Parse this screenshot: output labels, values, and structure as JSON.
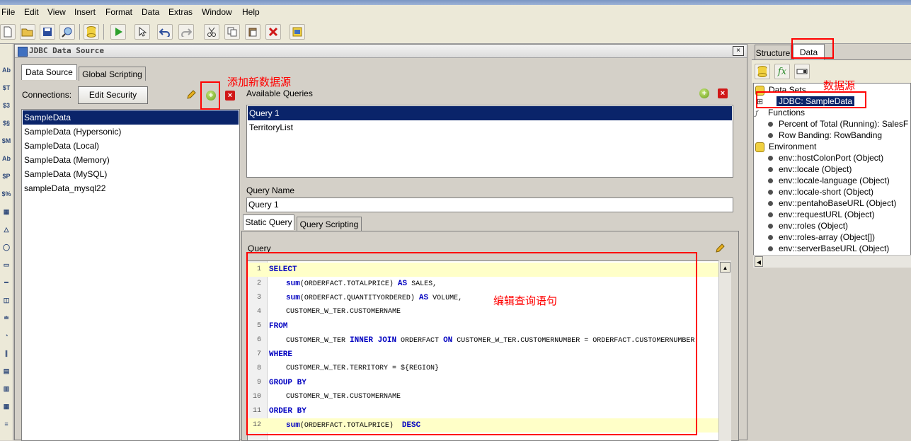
{
  "menu": [
    "File",
    "Edit",
    "View",
    "Insert",
    "Format",
    "Data",
    "Extras",
    "Window",
    "Help"
  ],
  "toolbar_icons": [
    "new-icon",
    "open-icon",
    "save-icon",
    "preview-icon",
    "datasource-icon",
    "run-icon",
    "select-icon",
    "undo-icon",
    "redo-icon",
    "cut-icon",
    "copy-icon",
    "paste-icon",
    "delete-icon",
    "report-icon"
  ],
  "dialog": {
    "title": "JDBC Data Source",
    "close_glyph": "×",
    "tabs": [
      "Data Source",
      "Global Scripting"
    ],
    "connections_label": "Connections:",
    "edit_security_label": "Edit Security",
    "connections": [
      "SampleData",
      "SampleData (Hypersonic)",
      "SampleData (Local)",
      "SampleData (Memory)",
      "SampleData (MySQL)",
      "sampleData_mysql22"
    ],
    "available_queries_label": "Available Queries",
    "queries": [
      "Query 1",
      "TerritoryList"
    ],
    "query_name_label": "Query Name",
    "query_name_value": "Query 1",
    "query_tabs": [
      "Static Query",
      "Query Scripting"
    ],
    "query_label": "Query",
    "code_lines": [
      [
        {
          "t": "SELECT",
          "k": true
        }
      ],
      [
        {
          "t": "    ",
          "k": false
        },
        {
          "t": "sum",
          "k": true
        },
        {
          "t": "(ORDERFACT.TOTALPRICE) ",
          "k": false
        },
        {
          "t": "AS",
          "k": true
        },
        {
          "t": " SALES,",
          "k": false
        }
      ],
      [
        {
          "t": "    ",
          "k": false
        },
        {
          "t": "sum",
          "k": true
        },
        {
          "t": "(ORDERFACT.QUANTITYORDERED) ",
          "k": false
        },
        {
          "t": "AS",
          "k": true
        },
        {
          "t": " VOLUME,",
          "k": false
        }
      ],
      [
        {
          "t": "    CUSTOMER_W_TER.CUSTOMERNAME",
          "k": false
        }
      ],
      [
        {
          "t": "FROM",
          "k": true
        }
      ],
      [
        {
          "t": "    CUSTOMER_W_TER ",
          "k": false
        },
        {
          "t": "INNER JOIN",
          "k": true
        },
        {
          "t": " ORDERFACT ",
          "k": false
        },
        {
          "t": "ON",
          "k": true
        },
        {
          "t": " CUSTOMER_W_TER.CUSTOMERNUMBER = ORDERFACT.CUSTOMERNUMBER",
          "k": false
        }
      ],
      [
        {
          "t": "WHERE",
          "k": true
        }
      ],
      [
        {
          "t": "    CUSTOMER_W_TER.TERRITORY = ${REGION}",
          "k": false
        }
      ],
      [
        {
          "t": "GROUP BY",
          "k": true
        }
      ],
      [
        {
          "t": "    CUSTOMER_W_TER.CUSTOMERNAME",
          "k": false
        }
      ],
      [
        {
          "t": "ORDER BY",
          "k": true
        }
      ],
      [
        {
          "t": "    ",
          "k": false
        },
        {
          "t": "sum",
          "k": true
        },
        {
          "t": "(ORDERFACT.TOTALPRICE)  ",
          "k": false
        },
        {
          "t": "DESC",
          "k": true
        }
      ]
    ]
  },
  "annotations": {
    "add_datasource": "添加新数据源",
    "edit_query": "编辑查询语句",
    "datasource": "数据源"
  },
  "right": {
    "tabs": [
      "Structure",
      "Data"
    ],
    "tree": [
      {
        "label": "Data Sets",
        "level": 0,
        "kind": "folder"
      },
      {
        "label": "JDBC: SampleData",
        "level": 1,
        "kind": "selected"
      },
      {
        "label": "Functions",
        "level": 0,
        "kind": "fx"
      },
      {
        "label": "Percent of Total (Running): SalesF",
        "level": 1,
        "kind": "bullet"
      },
      {
        "label": "Row Banding: RowBanding",
        "level": 1,
        "kind": "bullet"
      },
      {
        "label": "Environment",
        "level": 0,
        "kind": "folder"
      },
      {
        "label": "env::hostColonPort (Object)",
        "level": 1,
        "kind": "bullet"
      },
      {
        "label": "env::locale (Object)",
        "level": 1,
        "kind": "bullet"
      },
      {
        "label": "env::locale-language (Object)",
        "level": 1,
        "kind": "bullet"
      },
      {
        "label": "env::locale-short (Object)",
        "level": 1,
        "kind": "bullet"
      },
      {
        "label": "env::pentahoBaseURL (Object)",
        "level": 1,
        "kind": "bullet"
      },
      {
        "label": "env::requestURL (Object)",
        "level": 1,
        "kind": "bullet"
      },
      {
        "label": "env::roles (Object)",
        "level": 1,
        "kind": "bullet"
      },
      {
        "label": "env::roles-array (Object[])",
        "level": 1,
        "kind": "bullet"
      },
      {
        "label": "env::serverBaseURL (Object)",
        "level": 1,
        "kind": "bullet"
      }
    ]
  },
  "palette": [
    "Ab",
    "$T",
    "$3",
    "$§",
    "$M",
    "Ab",
    "$P",
    "$%",
    "▦",
    "△",
    "◯",
    "▭",
    "━",
    "◫",
    "≐",
    "◔",
    "∥",
    "▤",
    "▥",
    "▦",
    "≡"
  ]
}
